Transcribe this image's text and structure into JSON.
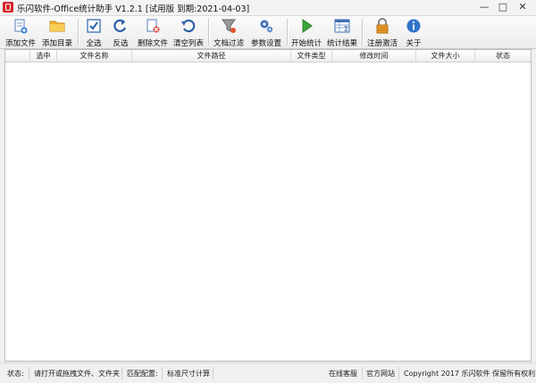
{
  "window": {
    "title": "乐闪软件-Office统计助手 V1.2.1 [试用版 到期:2021-04-03]",
    "controls": {
      "minimize": "—",
      "maximize": "□",
      "close": "✕"
    }
  },
  "toolbar": {
    "buttons": [
      {
        "label": "添加文件",
        "icon": "add-file-icon"
      },
      {
        "label": "添加目录",
        "icon": "add-folder-icon"
      },
      {
        "label": "全选",
        "icon": "select-all-icon"
      },
      {
        "label": "反选",
        "icon": "invert-selection-icon"
      },
      {
        "label": "删除文件",
        "icon": "delete-file-icon"
      },
      {
        "label": "清空列表",
        "icon": "clear-list-icon"
      },
      {
        "label": "文档过滤",
        "icon": "filter-icon"
      },
      {
        "label": "参数设置",
        "icon": "settings-gear-icon"
      },
      {
        "label": "开始统计",
        "icon": "play-icon"
      },
      {
        "label": "统计结果",
        "icon": "results-table-icon"
      },
      {
        "label": "注册激活",
        "icon": "lock-icon"
      },
      {
        "label": "关于",
        "icon": "info-icon"
      }
    ]
  },
  "table": {
    "columns": [
      "选中",
      "文件名称",
      "文件路径",
      "文件类型",
      "修改时间",
      "文件大小",
      "状态"
    ],
    "rows": []
  },
  "statusbar": {
    "status_label": "状态:",
    "status_text": "请打开或拖拽文件、文件夹",
    "match_label": "匹配配置:",
    "match_value": "标准尺寸计算",
    "online_support": "在线客服",
    "official_site": "官方网站",
    "copyright": "Copyright 2017 乐闪软件 保留所有权利"
  }
}
